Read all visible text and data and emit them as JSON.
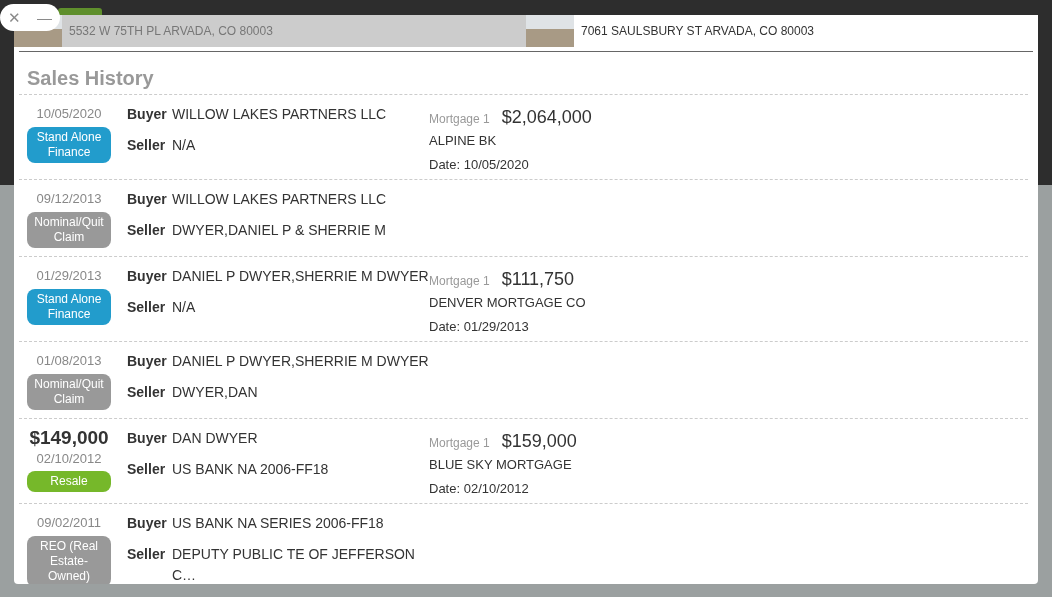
{
  "window_controls": {
    "close": "✕",
    "minimize": "—"
  },
  "tabs": [
    {
      "address": "5532 W 75TH PL ARVADA, CO 80003",
      "selected": false
    },
    {
      "address": "7061 SAULSBURY ST ARVADA, CO 80003",
      "selected": true
    }
  ],
  "title": "Sales History",
  "sales": [
    {
      "date": "10/05/2020",
      "type": {
        "label": "Stand Alone Finance",
        "kind": "finance"
      },
      "buyer_label": "Buyer",
      "buyer": "WILLOW LAKES PARTNERS LLC",
      "seller_label": "Seller",
      "seller": "N/A",
      "mortgage": {
        "label": "Mortgage 1",
        "amount": "$2,064,000",
        "lender": "ALPINE BK",
        "date": "Date: 10/05/2020"
      }
    },
    {
      "date": "09/12/2013",
      "type": {
        "label": "Nominal/Quit Claim",
        "kind": "nominal"
      },
      "buyer_label": "Buyer",
      "buyer": "WILLOW LAKES PARTNERS LLC",
      "seller_label": "Seller",
      "seller": "DWYER,DANIEL P & SHERRIE M"
    },
    {
      "date": "01/29/2013",
      "type": {
        "label": "Stand Alone Finance",
        "kind": "finance"
      },
      "buyer_label": "Buyer",
      "buyer": "DANIEL P DWYER,SHERRIE M DWYER",
      "seller_label": "Seller",
      "seller": "N/A",
      "mortgage": {
        "label": "Mortgage 1",
        "amount": "$111,750",
        "lender": "DENVER MORTGAGE CO",
        "date": "Date: 01/29/2013"
      }
    },
    {
      "date": "01/08/2013",
      "type": {
        "label": "Nominal/Quit Claim",
        "kind": "nominal"
      },
      "buyer_label": "Buyer",
      "buyer": "DANIEL P DWYER,SHERRIE M DWYER",
      "seller_label": "Seller",
      "seller": "DWYER,DAN"
    },
    {
      "price": "$149,000",
      "date": "02/10/2012",
      "type": {
        "label": "Resale",
        "kind": "resale"
      },
      "buyer_label": "Buyer",
      "buyer": "DAN DWYER",
      "seller_label": "Seller",
      "seller": "US BANK NA 2006-FF18",
      "mortgage": {
        "label": "Mortgage 1",
        "amount": "$159,000",
        "lender": "BLUE SKY MORTGAGE",
        "date": "Date: 02/10/2012"
      }
    },
    {
      "date": "09/02/2011",
      "type": {
        "label": "REO (Real Estate-Owned)",
        "kind": "reo"
      },
      "buyer_label": "Buyer",
      "buyer": "US BANK NA SERIES 2006-FF18",
      "seller_label": "Seller",
      "seller": "DEPUTY PUBLIC TE OF JEFFERSON C…"
    }
  ]
}
